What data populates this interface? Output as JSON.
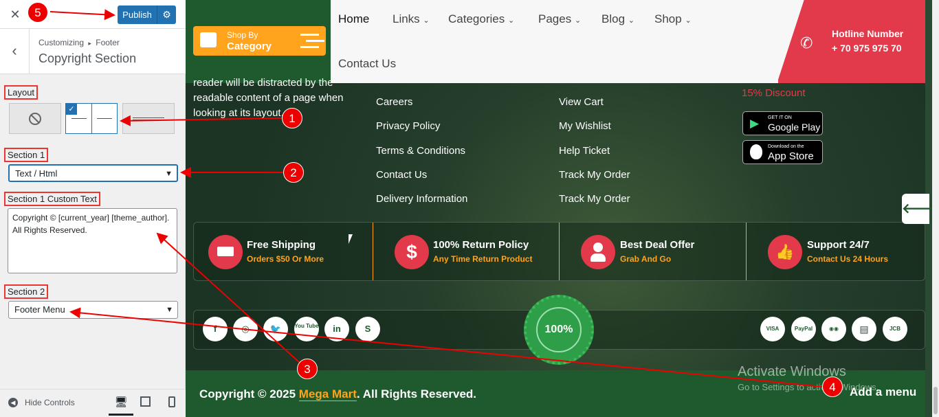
{
  "panel": {
    "publish_label": "Publish",
    "breadcrumb_a": "Customizing",
    "breadcrumb_sep": "▸",
    "breadcrumb_b": "Footer",
    "section_title": "Copyright Section",
    "layout_label": "Layout",
    "section1_label": "Section 1",
    "section1_value": "Text / Html",
    "custom_text_label": "Section 1 Custom Text",
    "custom_text_value": "Copyright © [current_year] [theme_author]. All Rights Reserved.",
    "section2_label": "Section 2",
    "section2_value": "Footer Menu",
    "hide_controls": "Hide Controls"
  },
  "site": {
    "shop_by": "Shop By",
    "category": "Category",
    "nav": [
      "Home",
      "Links",
      "Categories",
      "Pages",
      "Blog",
      "Shop",
      "Contact Us"
    ],
    "hotline_label": "Hotline Number",
    "hotline_number": "+ 70 975 975 70",
    "about_lines": [
      "reader will be distracted by the",
      "readable content of a page when",
      "looking at its layout."
    ],
    "links_col1": [
      "Careers",
      "Privacy Policy",
      "Terms & Conditions",
      "Contact Us",
      "Delivery Information"
    ],
    "links_col2": [
      "View Cart",
      "My Wishlist",
      "Help Ticket",
      "Track My Order",
      "Track My Order"
    ],
    "discount": "15% Discount",
    "google_small": "GET IT ON",
    "google_big": "Google Play",
    "apple_small": "Download on the",
    "apple_big": "App Store",
    "features": [
      {
        "title": "Free Shipping",
        "sub": "Orders $50 Or More"
      },
      {
        "title": "100% Return Policy",
        "sub": "Any Time Return Product"
      },
      {
        "title": "Best Deal Offer",
        "sub": "Grab And Go"
      },
      {
        "title": "Support 24/7",
        "sub": "Contact Us 24 Hours"
      }
    ],
    "social": [
      "f",
      "◎",
      "🐦",
      "You Tube",
      "in",
      "S"
    ],
    "badge": "100%",
    "payments": [
      "VISA",
      "PayPal",
      "◉◉",
      "▤",
      "JCB"
    ],
    "copy_pre": "Copyright © 2025 ",
    "copy_brand": "Mega Mart",
    "copy_post": ". All Rights Reserved.",
    "add_menu": "Add a menu",
    "watermark_1": "Activate Windows",
    "watermark_2": "Go to Settings to activate Windows."
  },
  "callouts": [
    "1",
    "2",
    "3",
    "4",
    "5"
  ],
  "colors": {
    "accent": "#2271b1",
    "brand_green": "#1e5a2d",
    "brand_orange": "#ffa41c",
    "brand_red": "#e23a4a"
  }
}
